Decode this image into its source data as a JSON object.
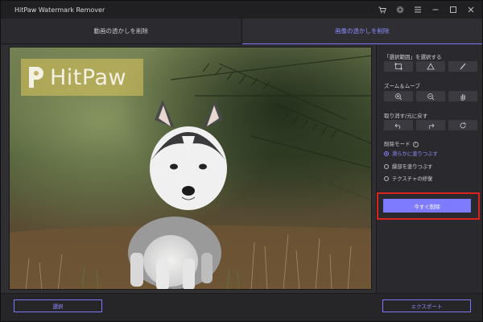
{
  "app": {
    "title": "HitPaw Watermark Remover"
  },
  "titlebar": {
    "icons": [
      "cart-icon",
      "settings-icon",
      "menu-icon",
      "minimize-icon",
      "maximize-icon",
      "close-icon"
    ]
  },
  "tabs": [
    {
      "label": "動画の透かしを削除",
      "active": false
    },
    {
      "label": "画像の透かしを削除",
      "active": true
    }
  ],
  "watermark": {
    "text": "HitPaw"
  },
  "panel": {
    "selection": {
      "label": "「選択範囲」を選択する",
      "tools": [
        "rectangle-select-icon",
        "polygon-select-icon",
        "brush-icon"
      ]
    },
    "zoom": {
      "label": "ズーム＆ムーブ",
      "tools": [
        "zoom-in-icon",
        "zoom-out-icon",
        "hand-icon"
      ]
    },
    "history": {
      "label": "取り消す/元に戻す",
      "tools": [
        "undo-icon",
        "redo-icon",
        "reset-icon"
      ]
    },
    "mode": {
      "label": "削除モード",
      "help": "?",
      "options": [
        {
          "label": "滑らかに塗りつぶす",
          "checked": true
        },
        {
          "label": "縁部を塗りつぶす",
          "checked": false
        },
        {
          "label": "テクスチャの修復",
          "checked": false
        }
      ]
    },
    "remove_button": "今すぐ削除"
  },
  "footer": {
    "select_button": "選択",
    "export_button": "エクスポート"
  },
  "colors": {
    "accent": "#7f7bff",
    "highlight": "#d8231f",
    "watermark": "#dfc65c"
  }
}
